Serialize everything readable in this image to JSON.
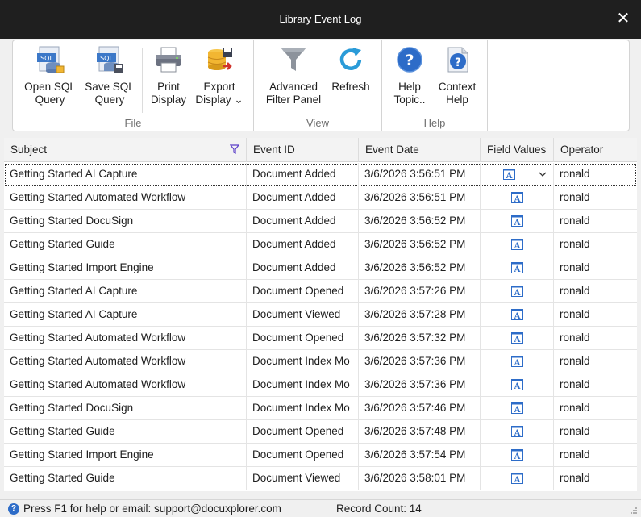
{
  "window": {
    "title": "Library Event Log",
    "close_glyph": "✕"
  },
  "ribbon": {
    "groups": [
      {
        "label": "File"
      },
      {
        "label": "View"
      },
      {
        "label": "Help"
      }
    ],
    "buttons": {
      "open_sql": "Open SQL\nQuery",
      "save_sql": "Save SQL\nQuery",
      "print": "Print\nDisplay",
      "export": "Export\nDisplay ⌄",
      "advanced_filter": "Advanced\nFilter Panel",
      "refresh": "Refresh",
      "help_topics": "Help\nTopic..",
      "context_help": "Context\nHelp"
    },
    "icons": {
      "open_sql": "sql-database-icon",
      "save_sql": "sql-save-icon",
      "print": "printer-icon",
      "export": "export-database-icon",
      "advanced_filter": "funnel-icon",
      "refresh": "refresh-icon",
      "help_topics": "help-circle-icon",
      "context_help": "context-help-icon"
    }
  },
  "grid": {
    "columns": [
      "Subject",
      "Event ID",
      "Event Date",
      "Field Values",
      "Operator"
    ],
    "rows": [
      {
        "subject": "Getting Started AI Capture",
        "event": "Document Added",
        "date": "3/6/2026 3:56:51 PM",
        "operator": "ronald"
      },
      {
        "subject": "Getting Started Automated Workflow",
        "event": "Document Added",
        "date": "3/6/2026 3:56:51 PM",
        "operator": "ronald"
      },
      {
        "subject": "Getting Started DocuSign",
        "event": "Document Added",
        "date": "3/6/2026 3:56:52 PM",
        "operator": "ronald"
      },
      {
        "subject": "Getting Started Guide",
        "event": "Document Added",
        "date": "3/6/2026 3:56:52 PM",
        "operator": "ronald"
      },
      {
        "subject": "Getting Started Import Engine",
        "event": "Document Added",
        "date": "3/6/2026 3:56:52 PM",
        "operator": "ronald"
      },
      {
        "subject": "Getting Started AI Capture",
        "event": "Document Opened",
        "date": "3/6/2026 3:57:26 PM",
        "operator": "ronald"
      },
      {
        "subject": "Getting Started AI Capture",
        "event": "Document Viewed",
        "date": "3/6/2026 3:57:28 PM",
        "operator": "ronald"
      },
      {
        "subject": "Getting Started Automated Workflow",
        "event": "Document Opened",
        "date": "3/6/2026 3:57:32 PM",
        "operator": "ronald"
      },
      {
        "subject": "Getting Started Automated Workflow",
        "event": "Document Index Mo",
        "date": "3/6/2026 3:57:36 PM",
        "operator": "ronald"
      },
      {
        "subject": "Getting Started Automated Workflow",
        "event": "Document Index Mo",
        "date": "3/6/2026 3:57:36 PM",
        "operator": "ronald"
      },
      {
        "subject": "Getting Started DocuSign",
        "event": "Document Index Mo",
        "date": "3/6/2026 3:57:46 PM",
        "operator": "ronald"
      },
      {
        "subject": "Getting Started Guide",
        "event": "Document Opened",
        "date": "3/6/2026 3:57:48 PM",
        "operator": "ronald"
      },
      {
        "subject": "Getting Started Import Engine",
        "event": "Document Opened",
        "date": "3/6/2026 3:57:54 PM",
        "operator": "ronald"
      },
      {
        "subject": "Getting Started Guide",
        "event": "Document Viewed",
        "date": "3/6/2026 3:58:01 PM",
        "operator": "ronald"
      }
    ]
  },
  "status": {
    "help_glyph": "?",
    "message": "Press F1 for help or email: support@docuxplorer.com",
    "record_count": "Record Count: 14"
  },
  "colors": {
    "accent": "#2d6cc8",
    "titlebar": "#1f1f1f"
  }
}
